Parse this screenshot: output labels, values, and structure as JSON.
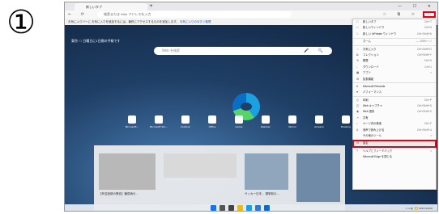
{
  "step": {
    "number": "①"
  },
  "browser": {
    "tab_title": "新しいタブ",
    "tab_add": "+",
    "window_controls": "— ☐ ✕",
    "nav_buttons": "← ⟳",
    "url": "検索または Web アドレスを入力",
    "toolbar_icons": "☆ ⧉ ✩",
    "menu_button": "···",
    "infobar_text": "お気に入りバーに お気に入りを追加するには、最終にアクセスするものを追加します。",
    "infobar_link": "お気に入りの今すぐ管理"
  },
  "newtab": {
    "weather": "東京 ☁ 日曜日に1日間の予報です",
    "search_placeholder": "Web を検索",
    "search_icons": "🎤 🔍",
    "quicklinks": [
      {
        "label": "Microsoft..."
      },
      {
        "label": "Microsoft Sto..."
      },
      {
        "label": "Outlook"
      },
      {
        "label": "Office"
      },
      {
        "label": "Game"
      },
      {
        "label": "Rakuten"
      },
      {
        "label": "Yahoo!"
      },
      {
        "label": "Amazon"
      },
      {
        "label": "Booking"
      }
    ],
    "feed_headline_1": "【有名医師の警告】糖尿病の…",
    "feed_headline_2": "サッカー日本… 選挙前の…"
  },
  "taskbar": {
    "tray": "ヘ A 🔊 📶 2023/10/06"
  },
  "menu": {
    "items": [
      {
        "icon": "□",
        "label": "新しいタブ",
        "shortcut": "Ctrl+T"
      },
      {
        "icon": "□",
        "label": "新しいウィンドウ",
        "shortcut": "Ctrl+N"
      },
      {
        "icon": "□",
        "label": "新しい InPrivate ウィンドウ",
        "shortcut": "Ctrl+Shift+N"
      },
      {
        "icon": "",
        "label": "ズーム",
        "shortcut": "— 100% +  ⤢"
      },
      {
        "icon": "☆",
        "label": "お気に入り",
        "shortcut": "Ctrl+Shift+O"
      },
      {
        "icon": "⧉",
        "label": "コレクション",
        "shortcut": "Ctrl+Shift+Y"
      },
      {
        "icon": "⟲",
        "label": "履歴",
        "shortcut": "Ctrl+H"
      },
      {
        "icon": "↓",
        "label": "ダウンロード",
        "shortcut": "Ctrl+J"
      },
      {
        "icon": "▦",
        "label": "アプリ",
        "shortcut": ">"
      },
      {
        "icon": "⚙",
        "label": "拡張機能",
        "shortcut": ""
      },
      {
        "icon": "♥",
        "label": "Microsoft Rewards",
        "shortcut": ""
      },
      {
        "icon": "♥",
        "label": "パフォーマンス",
        "shortcut": ""
      },
      {
        "icon": "⎙",
        "label": "印刷",
        "shortcut": "Ctrl+P"
      },
      {
        "icon": "◫",
        "label": "Web キャプチャ",
        "shortcut": "Ctrl+Shift+S"
      },
      {
        "icon": "◉",
        "label": "Web 選択",
        "shortcut": "Ctrl+Shift+X"
      },
      {
        "icon": "↗",
        "label": "共有",
        "shortcut": ""
      },
      {
        "icon": "⌕",
        "label": "ページ内の検索",
        "shortcut": "Ctrl+F"
      },
      {
        "icon": "A",
        "label": "音声で読み上げる",
        "shortcut": "Ctrl+Shift+U"
      },
      {
        "icon": "",
        "label": "その他のツール",
        "shortcut": ">"
      },
      {
        "icon": "⚙",
        "label": "設定",
        "shortcut": ""
      },
      {
        "icon": "?",
        "label": "ヘルプとフィードバック",
        "shortcut": ">"
      },
      {
        "icon": "",
        "label": "Microsoft Edge を閉じる",
        "shortcut": ""
      }
    ]
  },
  "colors": {
    "highlight": "#e60012",
    "accent": "#1a5dc9"
  }
}
